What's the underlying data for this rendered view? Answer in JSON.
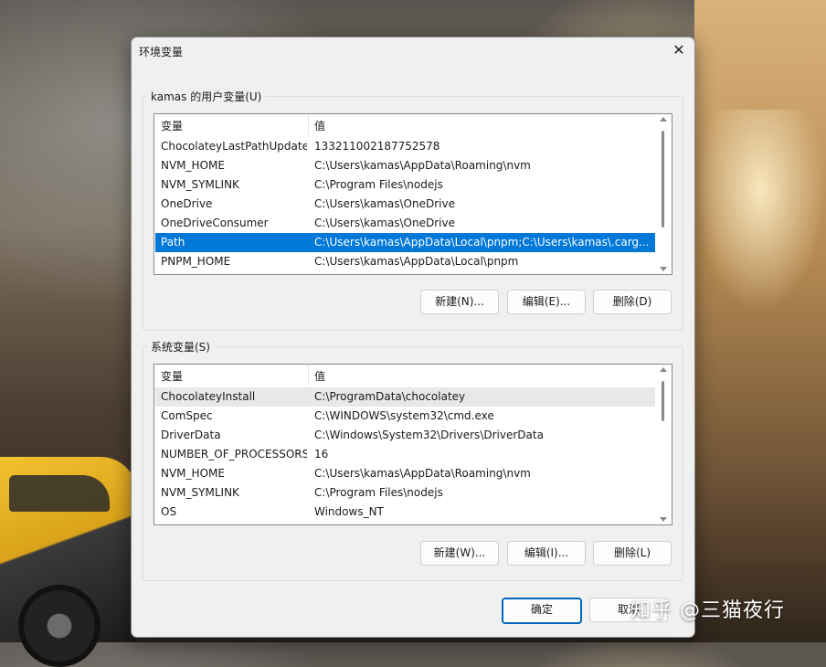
{
  "window": {
    "title": "环境变量",
    "close_glyph": "✕"
  },
  "user_group": {
    "label": "kamas 的用户变量(U)",
    "columns": [
      "变量",
      "值"
    ],
    "rows": [
      {
        "name": "ChocolateyLastPathUpdate",
        "value": "133211002187752578"
      },
      {
        "name": "NVM_HOME",
        "value": "C:\\Users\\kamas\\AppData\\Roaming\\nvm"
      },
      {
        "name": "NVM_SYMLINK",
        "value": "C:\\Program Files\\nodejs"
      },
      {
        "name": "OneDrive",
        "value": "C:\\Users\\kamas\\OneDrive"
      },
      {
        "name": "OneDriveConsumer",
        "value": "C:\\Users\\kamas\\OneDrive"
      },
      {
        "name": "Path",
        "value": "C:\\Users\\kamas\\AppData\\Local\\pnpm;C:\\Users\\kamas\\.carg..."
      },
      {
        "name": "PNPM_HOME",
        "value": "C:\\Users\\kamas\\AppData\\Local\\pnpm"
      }
    ],
    "selected_row": "Path",
    "buttons": {
      "new": "新建(N)...",
      "edit": "编辑(E)...",
      "delete": "删除(D)"
    }
  },
  "system_group": {
    "label": "系统变量(S)",
    "columns": [
      "变量",
      "值"
    ],
    "rows": [
      {
        "name": "ChocolateyInstall",
        "value": "C:\\ProgramData\\chocolatey"
      },
      {
        "name": "ComSpec",
        "value": "C:\\WINDOWS\\system32\\cmd.exe"
      },
      {
        "name": "DriverData",
        "value": "C:\\Windows\\System32\\Drivers\\DriverData"
      },
      {
        "name": "NUMBER_OF_PROCESSORS",
        "value": "16"
      },
      {
        "name": "NVM_HOME",
        "value": "C:\\Users\\kamas\\AppData\\Roaming\\nvm"
      },
      {
        "name": "NVM_SYMLINK",
        "value": "C:\\Program Files\\nodejs"
      },
      {
        "name": "OS",
        "value": "Windows_NT"
      }
    ],
    "hovered_row": "ChocolateyInstall",
    "buttons": {
      "new": "新建(W)...",
      "edit": "编辑(I)...",
      "delete": "删除(L)"
    }
  },
  "footer": {
    "ok": "确定",
    "cancel": "取消"
  },
  "watermark": "知乎 @三猫夜行",
  "colors": {
    "selection": "#0078d7",
    "ok_border": "#0067c0"
  }
}
